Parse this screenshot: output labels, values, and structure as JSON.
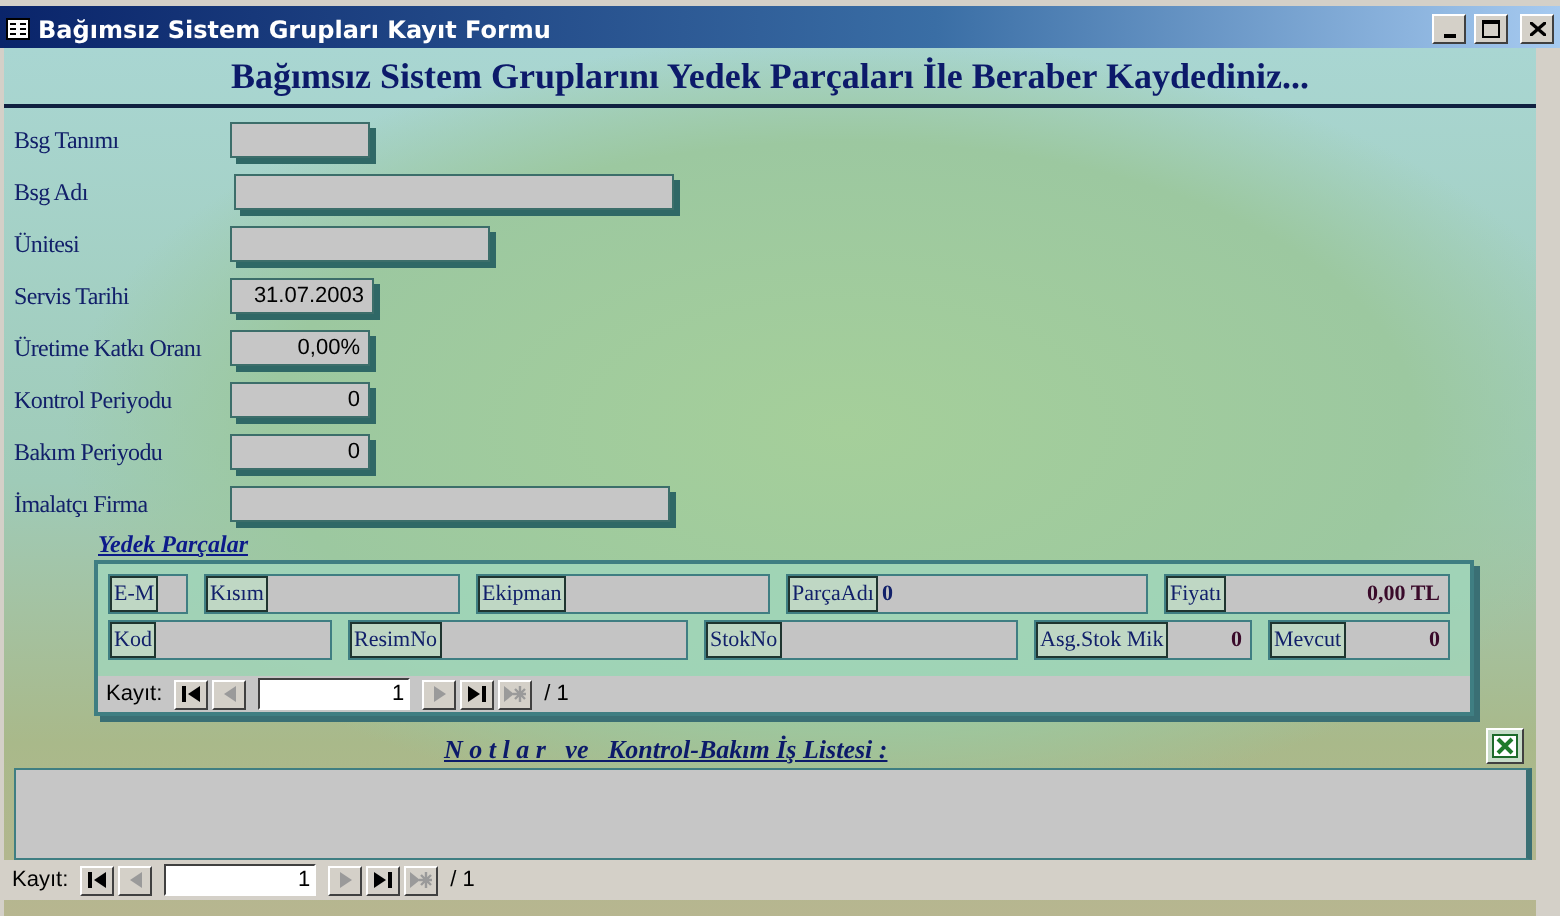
{
  "window": {
    "title": "Bağımsız Sistem Grupları Kayıt Formu"
  },
  "header": "Bağımsız Sistem Gruplarını Yedek Parçaları İle Beraber Kaydediniz...",
  "fields": [
    {
      "label": "Bsg Tanımı"
    },
    {
      "label": "Bsg Adı"
    },
    {
      "label": "Ünitesi"
    },
    {
      "label": "Servis Tarihi",
      "value": "31.07.2003"
    },
    {
      "label": "Üretime Katkı Oranı",
      "value": "0,00%"
    },
    {
      "label": "Kontrol Periyodu",
      "value": "0"
    },
    {
      "label": "Bakım Periyodu",
      "value": "0"
    },
    {
      "label": "İmalatçı Firma"
    }
  ],
  "subform": {
    "title": "Yedek Parçalar",
    "rows": [
      [
        {
          "label": "E-M"
        },
        {
          "label": "Kısım"
        },
        {
          "label": "Ekipman"
        },
        {
          "label": "ParçaAdı",
          "value": "0"
        },
        {
          "label": "Fiyatı",
          "value": "0,00 TL"
        }
      ],
      [
        {
          "label": "Kod"
        },
        {
          "label": "ResimNo"
        },
        {
          "label": "StokNo"
        },
        {
          "label": "Asg.Stok Mik",
          "value": "0"
        },
        {
          "label": "Mevcut",
          "value": "0"
        }
      ]
    ],
    "navigator": {
      "label": "Kayıt:",
      "record": "1",
      "total": "/ 1",
      "buttons": [
        {
          "kind": "first",
          "disabled": false
        },
        {
          "kind": "prev",
          "disabled": true
        },
        {
          "kind": "next",
          "disabled": true
        },
        {
          "kind": "last",
          "disabled": false
        },
        {
          "kind": "new",
          "disabled": true
        }
      ]
    }
  },
  "notes": {
    "title": "N o t l a r   ve   Kontrol-Bakım İş Listesi :"
  },
  "navigator": {
    "label": "Kayıt:",
    "record": "1",
    "total": "/ 1",
    "buttons": [
      {
        "kind": "first",
        "disabled": false
      },
      {
        "kind": "prev",
        "disabled": true
      },
      {
        "kind": "next",
        "disabled": true
      },
      {
        "kind": "last",
        "disabled": false
      },
      {
        "kind": "new",
        "disabled": true
      }
    ]
  }
}
